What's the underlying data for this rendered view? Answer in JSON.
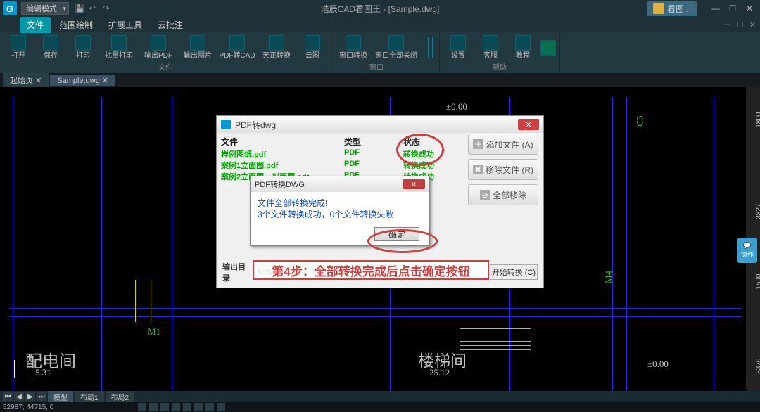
{
  "titlebar": {
    "logo": "G",
    "mode": "编辑模式",
    "app_title": "浩辰CAD看图王 - [Sample.dwg]",
    "user_label": "看图...",
    "min": "—",
    "max": "☐",
    "close": "✕"
  },
  "menubar": {
    "tabs": [
      "文件",
      "范围绘制",
      "扩展工具",
      "云批注"
    ],
    "mdi": {
      "min": "—",
      "restore": "☐",
      "close": "✕"
    }
  },
  "ribbon": {
    "groups": [
      {
        "label": "文件",
        "items": [
          "打开",
          "保存",
          "打印",
          "批量打印",
          "输出PDF",
          "输出图片",
          "PDF转CAD",
          "天正转换",
          "云图"
        ]
      },
      {
        "label": "窗口",
        "items": [
          "窗口转换",
          "窗口全部关闭"
        ]
      },
      {
        "label": "帮助",
        "items": [
          "设置",
          "客服",
          "教程",
          ""
        ]
      }
    ]
  },
  "doctabs": {
    "start": "起始页",
    "active": "Sample.dwg",
    "close": "✕"
  },
  "drawing": {
    "dim1": "±0.00",
    "room1": "配电间",
    "room1_dim": "5.31",
    "label_m1": "M1",
    "label_c3": "C3",
    "label_m4": "M4",
    "room2": "楼梯间",
    "room2_dim": "25.12",
    "dim_bottom": "±0.00",
    "r1": "1800",
    "r2": "3827",
    "r3": "1500",
    "r4": "3370"
  },
  "dialog": {
    "title": "PDF转dwg",
    "headers": {
      "file": "文件",
      "type": "类型",
      "status": "状态"
    },
    "rows": [
      {
        "file": "样例图纸.pdf",
        "type": "PDF",
        "status": "转换成功"
      },
      {
        "file": "案例1立面图.pdf",
        "type": "PDF",
        "status": "转换成功"
      },
      {
        "file": "案例2立面图、剖面图.pdf",
        "type": "PDF",
        "status": "转换成功"
      }
    ],
    "output_label": "输出目录",
    "output_path": "C:\\Users\\...",
    "start_btn": "开始转换 (C)"
  },
  "side_buttons": {
    "add": "添加文件 (A)",
    "remove": "移除文件 (R)",
    "removeall": "全部移除"
  },
  "msgbox": {
    "title": "PDF转换DWG",
    "line1": "文件全部转换完成!",
    "line2": "3个文件转换成功，0个文件转换失败",
    "ok": "确定"
  },
  "annotation": "第4步：全部转换完成后点击确定按钮",
  "bottomtabs": {
    "model": "模型",
    "layout1": "布局1",
    "layout2": "布局2"
  },
  "statusbar": {
    "coords": "52987, 44715, 0"
  },
  "float": "协作"
}
